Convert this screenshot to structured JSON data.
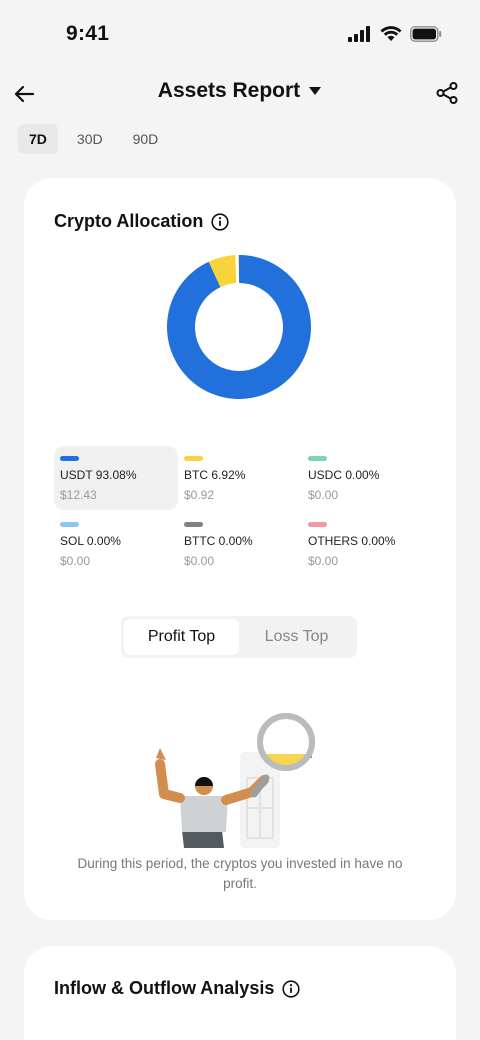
{
  "status_bar": {
    "time": "9:41"
  },
  "header": {
    "title": "Assets Report"
  },
  "period_tabs": [
    {
      "label": "7D",
      "active": true
    },
    {
      "label": "30D",
      "active": false
    },
    {
      "label": "90D",
      "active": false
    }
  ],
  "allocation": {
    "title": "Crypto Allocation",
    "legend": [
      {
        "name": "USDT 93.08%",
        "amount": "$12.43",
        "color": "#2270db"
      },
      {
        "name": "BTC 6.92%",
        "amount": "$0.92",
        "color": "#f8d33a"
      },
      {
        "name": "USDC 0.00%",
        "amount": "$0.00",
        "color": "#7dd3b5"
      },
      {
        "name": "SOL 0.00%",
        "amount": "$0.00",
        "color": "#8fc6ef"
      },
      {
        "name": "BTTC 0.00%",
        "amount": "$0.00",
        "color": "#7c8287"
      },
      {
        "name": "OTHERS 0.00%",
        "amount": "$0.00",
        "color": "#f29aa3"
      }
    ],
    "segments": [
      {
        "label": "Profit Top",
        "active": true
      },
      {
        "label": "Loss Top",
        "active": false
      }
    ],
    "empty_text": "During this period, the cryptos you invested in have no profit."
  },
  "chart_data": {
    "type": "pie",
    "categories": [
      "USDT",
      "BTC",
      "USDC",
      "SOL",
      "BTTC",
      "OTHERS"
    ],
    "values": [
      93.08,
      6.92,
      0.0,
      0.0,
      0.0,
      0.0
    ],
    "amounts": [
      "$12.43",
      "$0.92",
      "$0.00",
      "$0.00",
      "$0.00",
      "$0.00"
    ],
    "colors": [
      "#2270db",
      "#f8d33a",
      "#7dd3b5",
      "#8fc6ef",
      "#7c8287",
      "#f29aa3"
    ]
  },
  "flow": {
    "title": "Inflow & Outflow Analysis"
  }
}
